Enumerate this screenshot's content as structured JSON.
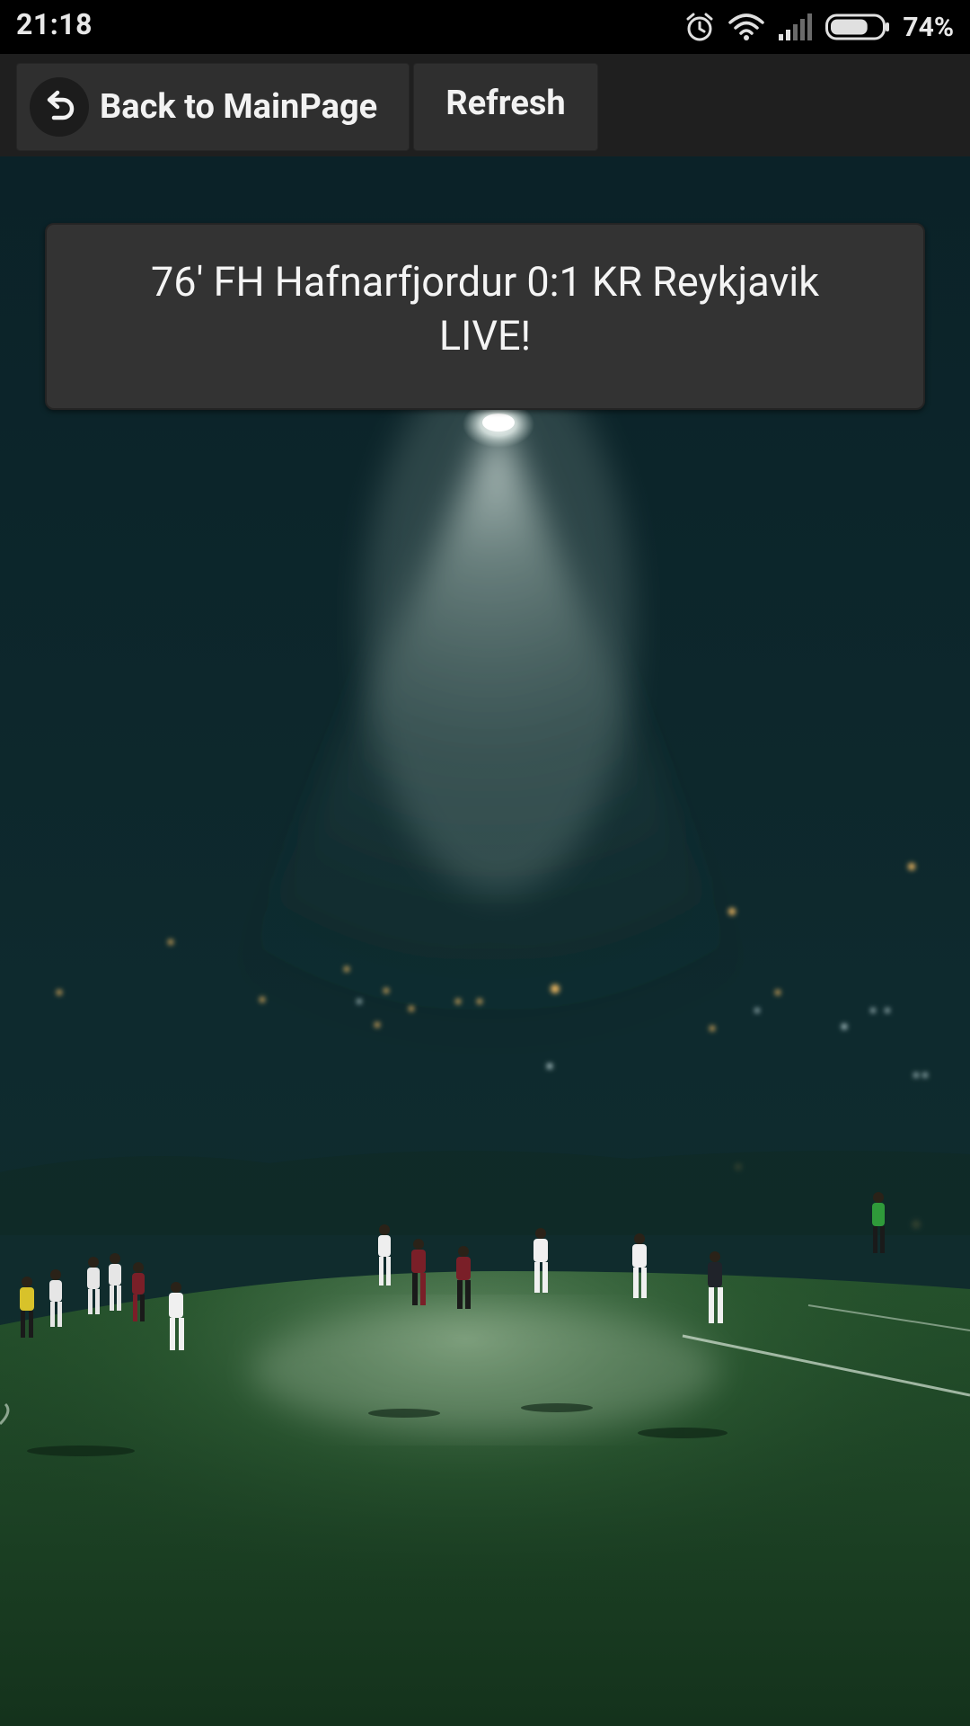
{
  "status_bar": {
    "time": "21:18",
    "battery_percent": "74%",
    "battery_level": 0.74,
    "icons": [
      "alarm-icon",
      "wifi-icon",
      "signal-icon",
      "battery-icon"
    ]
  },
  "action_bar": {
    "back_label": "Back to MainPage",
    "back_icon": "undo-arrow-icon",
    "refresh_label": "Refresh"
  },
  "match": {
    "line1": "76' FH Hafnarfjordur 0:1 KR Reykjavik",
    "line2": "LIVE!"
  },
  "background": {
    "description_icon": "football-pitch-night-photo",
    "sky_color": "#0d2329",
    "pitch_color": "#1f4a28",
    "floodlight_color": "#e9f2ee"
  }
}
